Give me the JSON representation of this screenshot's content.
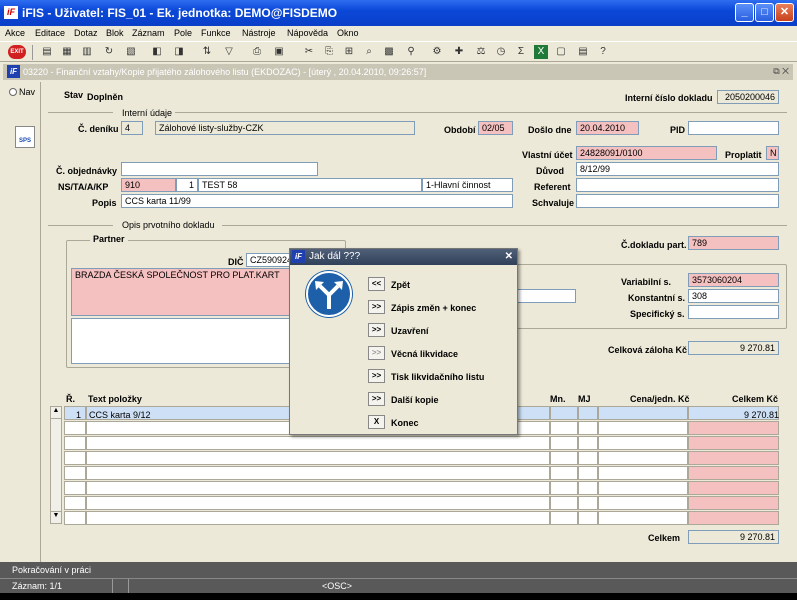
{
  "window": {
    "title": "iFIS - Uživatel: FIS_01 - Ek. jednotka: DEMO@FISDEMO",
    "min": "_",
    "max": "□",
    "close": "✕",
    "logo": "iF"
  },
  "menu": [
    "Akce",
    "Editace",
    "Dotaz",
    "Blok",
    "Záznam",
    "Pole",
    "Funkce",
    "Nástroje",
    "Nápověda",
    "Okno"
  ],
  "toolbar": {
    "exit": "EXIT"
  },
  "doc": {
    "title": "03220 - Finanční vztahy/Kopie přijatého zálohového listu (EKDOZAC) - [úterý , 20.04.2010, 09:26:57]",
    "controls": "⧉ ✕"
  },
  "left": {
    "nav": "Nav",
    "sps": "SPS"
  },
  "header": {
    "stav_label": "Stav",
    "stav_value": "Doplněn",
    "interni_cislo_label": "Interní číslo dokladu",
    "interni_cislo_value": "2050200046"
  },
  "interni": {
    "section": "Interní údaje",
    "cdeniku_label": "Č. deníku",
    "cdeniku_value": "4",
    "cdeniku_name": "Zálohové listy-služby-CZK",
    "obdobi_label": "Období",
    "obdobi_value": "02/05",
    "doslo_label": "Došlo dne",
    "doslo_value": "20.04.2010",
    "pid_label": "PID",
    "pid_value": "",
    "vlastni_ucet_label": "Vlastní účet",
    "vlastni_ucet_value": "24828091/0100",
    "proplatit_label": "Proplatit",
    "proplatit_value": "N",
    "objednavky_label": "Č. objednávky",
    "objednavky_value": "",
    "duvod_label": "Důvod",
    "duvod_value": "8/12/99",
    "ns_label": "NS/TA/A/KP",
    "ns_value": "910",
    "ta_value": "1",
    "a_value": "TEST 58",
    "kp_value": "1-Hlavní činnost",
    "referent_label": "Referent",
    "referent_value": "",
    "popis_label": "Popis",
    "popis_value": "CCS karta 11/99",
    "schvaluje_label": "Schvaluje",
    "schvaluje_value": ""
  },
  "prvotni": {
    "section": "Opis prvotního dokladu",
    "partner_label": "Partner",
    "dic_label": "DIČ",
    "dic_value": "CZ590924",
    "partner_name": "BRAZDA ČESKÁ SPOLEČNOST PRO PLAT.KART",
    "cdokladu_label": "Č.dokladu part.",
    "cdokladu_value": "789",
    "variabilni_label": "Variabilní s.",
    "variabilni_value": "3573060204",
    "konstantni_label": "Konstantní s.",
    "konstantni_value": "308",
    "specificky_label": "Specifický s.",
    "specificky_value": "",
    "celkova_label": "Celková záloha Kč",
    "celkova_value": "9 270.81"
  },
  "table": {
    "headers": {
      "r": "Ř.",
      "text": "Text položky",
      "mn": "Mn.",
      "mj": "MJ",
      "cena": "Cena/jedn. Kč",
      "celkem": "Celkem Kč"
    },
    "rows": [
      {
        "r": "1",
        "text": "CCS karta 9/12",
        "celkem": "9 270.81"
      }
    ],
    "celkem_label": "Celkem",
    "celkem_value": "9 270.81"
  },
  "dialog": {
    "title": "Jak dál ???",
    "close": "✕",
    "options": [
      {
        "btn": "<<",
        "label": "Zpět"
      },
      {
        "btn": ">>",
        "label": "Zápis změn + konec"
      },
      {
        "btn": ">>",
        "label": "Uzavření"
      },
      {
        "btn": ">>",
        "label": "Věcná likvidace"
      },
      {
        "btn": ">>",
        "label": "Tisk likvidačního listu"
      },
      {
        "btn": ">>",
        "label": "Další kopie"
      },
      {
        "btn": "X",
        "label": "Konec"
      }
    ]
  },
  "status": {
    "line1": "Pokračování v práci",
    "line2": "Záznam: 1/1",
    "osc": "<OSC>"
  }
}
